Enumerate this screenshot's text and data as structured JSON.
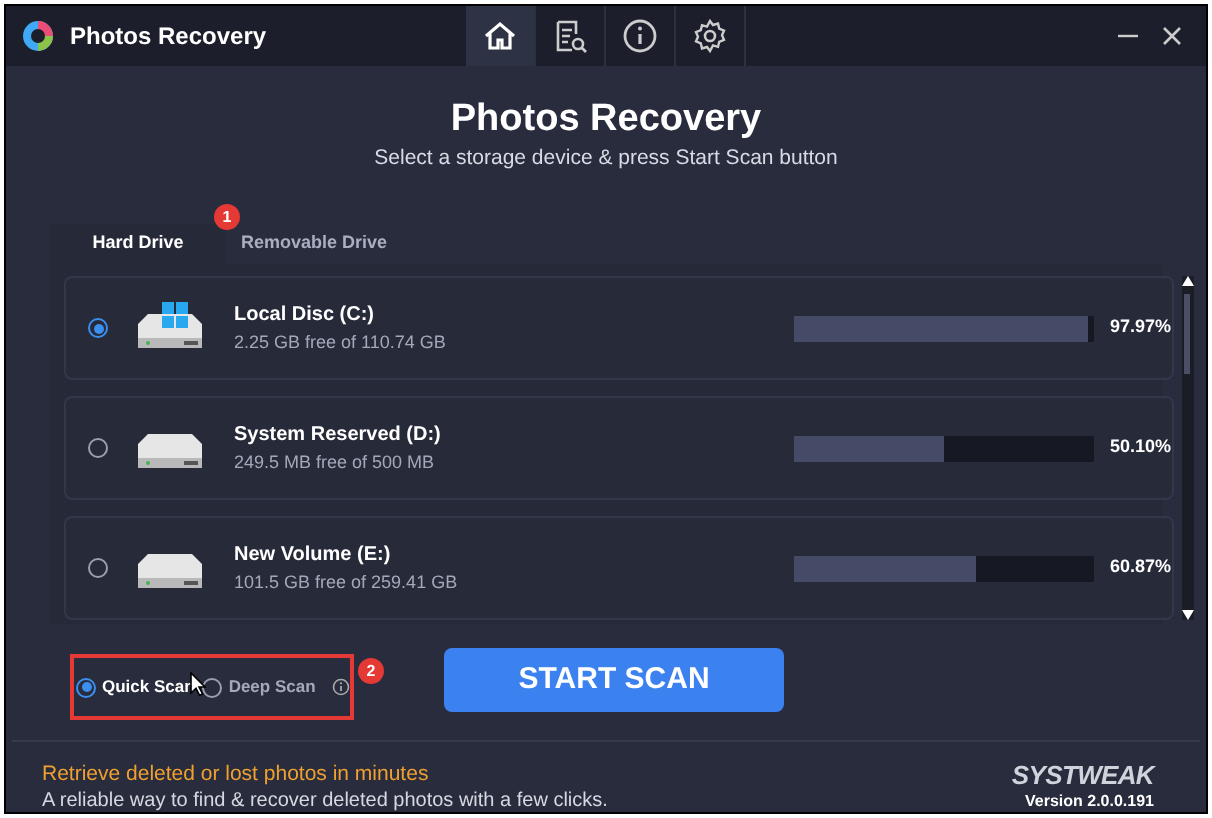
{
  "window": {
    "title": "Photos Recovery"
  },
  "nav": [
    {
      "kind": "home",
      "selected": true
    },
    {
      "kind": "scan-log",
      "selected": false
    },
    {
      "kind": "info",
      "selected": false
    },
    {
      "kind": "settings",
      "selected": false
    }
  ],
  "header": {
    "title": "Photos Recovery",
    "subtitle": "Select a storage device & press Start Scan button"
  },
  "tabs": [
    {
      "label": "Hard Drive",
      "selected": true
    },
    {
      "label": "Removable Drive",
      "selected": false
    }
  ],
  "annotations": [
    "1",
    "2"
  ],
  "drives": [
    {
      "name": "Local Disc (C:)",
      "space": "2.25 GB free of 110.74 GB",
      "level": 0.9797,
      "percent": "97.97%",
      "selected": true,
      "system": true
    },
    {
      "name": "System Reserved (D:)",
      "space": "249.5 MB free of 500 MB",
      "level": 0.501,
      "percent": "50.10%",
      "selected": false,
      "system": false
    },
    {
      "name": "New Volume (E:)",
      "space": "101.5 GB free of 259.41 GB",
      "level": 0.6087,
      "percent": "60.87%",
      "selected": false,
      "system": false
    }
  ],
  "scan_modes": [
    {
      "label": "Quick Scan",
      "selected": true
    },
    {
      "label": "Deep Scan",
      "selected": false
    }
  ],
  "start_button": "START SCAN",
  "footer": {
    "headline": "Retrieve deleted or lost photos in minutes",
    "text": "A reliable way to find & recover deleted photos with a few clicks.",
    "brand": "SYSTWEAK",
    "version": "Version 2.0.0.191"
  }
}
